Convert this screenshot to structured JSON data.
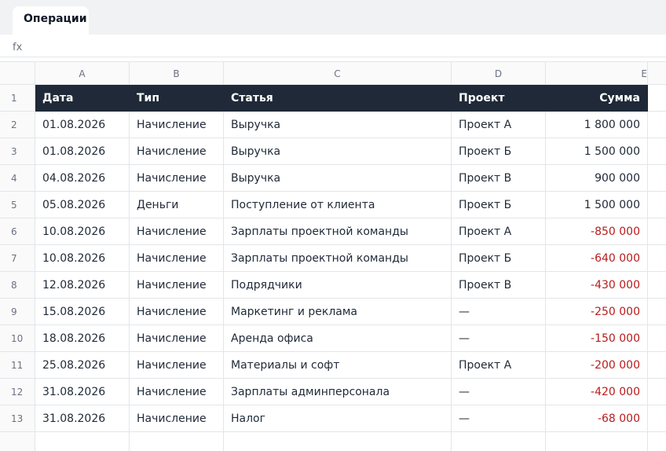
{
  "sheet_tabs": [
    {
      "label": "Операции",
      "active": true
    }
  ],
  "formula_bar": {
    "label": "fx",
    "value": ""
  },
  "column_letters": [
    "A",
    "B",
    "C",
    "D",
    "E"
  ],
  "header": {
    "row_number": "1",
    "date": "Дата",
    "type": "Тип",
    "article": "Статья",
    "project": "Проект",
    "amount": "Сумма"
  },
  "rows": [
    {
      "n": "2",
      "date": "01.08.2026",
      "type": "Начисление",
      "article": "Выручка",
      "project": "Проект А",
      "amount": "1 800 000",
      "negative": false
    },
    {
      "n": "3",
      "date": "01.08.2026",
      "type": "Начисление",
      "article": "Выручка",
      "project": "Проект Б",
      "amount": "1 500 000",
      "negative": false
    },
    {
      "n": "4",
      "date": "04.08.2026",
      "type": "Начисление",
      "article": "Выручка",
      "project": "Проект В",
      "amount": "900 000",
      "negative": false
    },
    {
      "n": "5",
      "date": "05.08.2026",
      "type": "Деньги",
      "article": "Поступление от клиента",
      "project": "Проект Б",
      "amount": "1 500 000",
      "negative": false
    },
    {
      "n": "6",
      "date": "10.08.2026",
      "type": "Начисление",
      "article": "Зарплаты проектной команды",
      "project": "Проект А",
      "amount": "-850 000",
      "negative": true
    },
    {
      "n": "7",
      "date": "10.08.2026",
      "type": "Начисление",
      "article": "Зарплаты проектной команды",
      "project": "Проект Б",
      "amount": "-640 000",
      "negative": true
    },
    {
      "n": "8",
      "date": "12.08.2026",
      "type": "Начисление",
      "article": "Подрядчики",
      "project": "Проект В",
      "amount": "-430 000",
      "negative": true
    },
    {
      "n": "9",
      "date": "15.08.2026",
      "type": "Начисление",
      "article": "Маркетинг и реклама",
      "project": "—",
      "amount": "-250 000",
      "negative": true
    },
    {
      "n": "10",
      "date": "18.08.2026",
      "type": "Начисление",
      "article": "Аренда офиса",
      "project": "—",
      "amount": "-150 000",
      "negative": true
    },
    {
      "n": "11",
      "date": "25.08.2026",
      "type": "Начисление",
      "article": "Материалы и софт",
      "project": "Проект А",
      "amount": "-200 000",
      "negative": true
    },
    {
      "n": "12",
      "date": "31.08.2026",
      "type": "Начисление",
      "article": "Зарплаты админперсонала",
      "project": "—",
      "amount": "-420 000",
      "negative": true
    },
    {
      "n": "13",
      "date": "31.08.2026",
      "type": "Начисление",
      "article": "Налог",
      "project": "—",
      "amount": "-68 000",
      "negative": true
    }
  ],
  "colors": {
    "header_bg": "#1f2937",
    "negative": "#b91c1c"
  }
}
